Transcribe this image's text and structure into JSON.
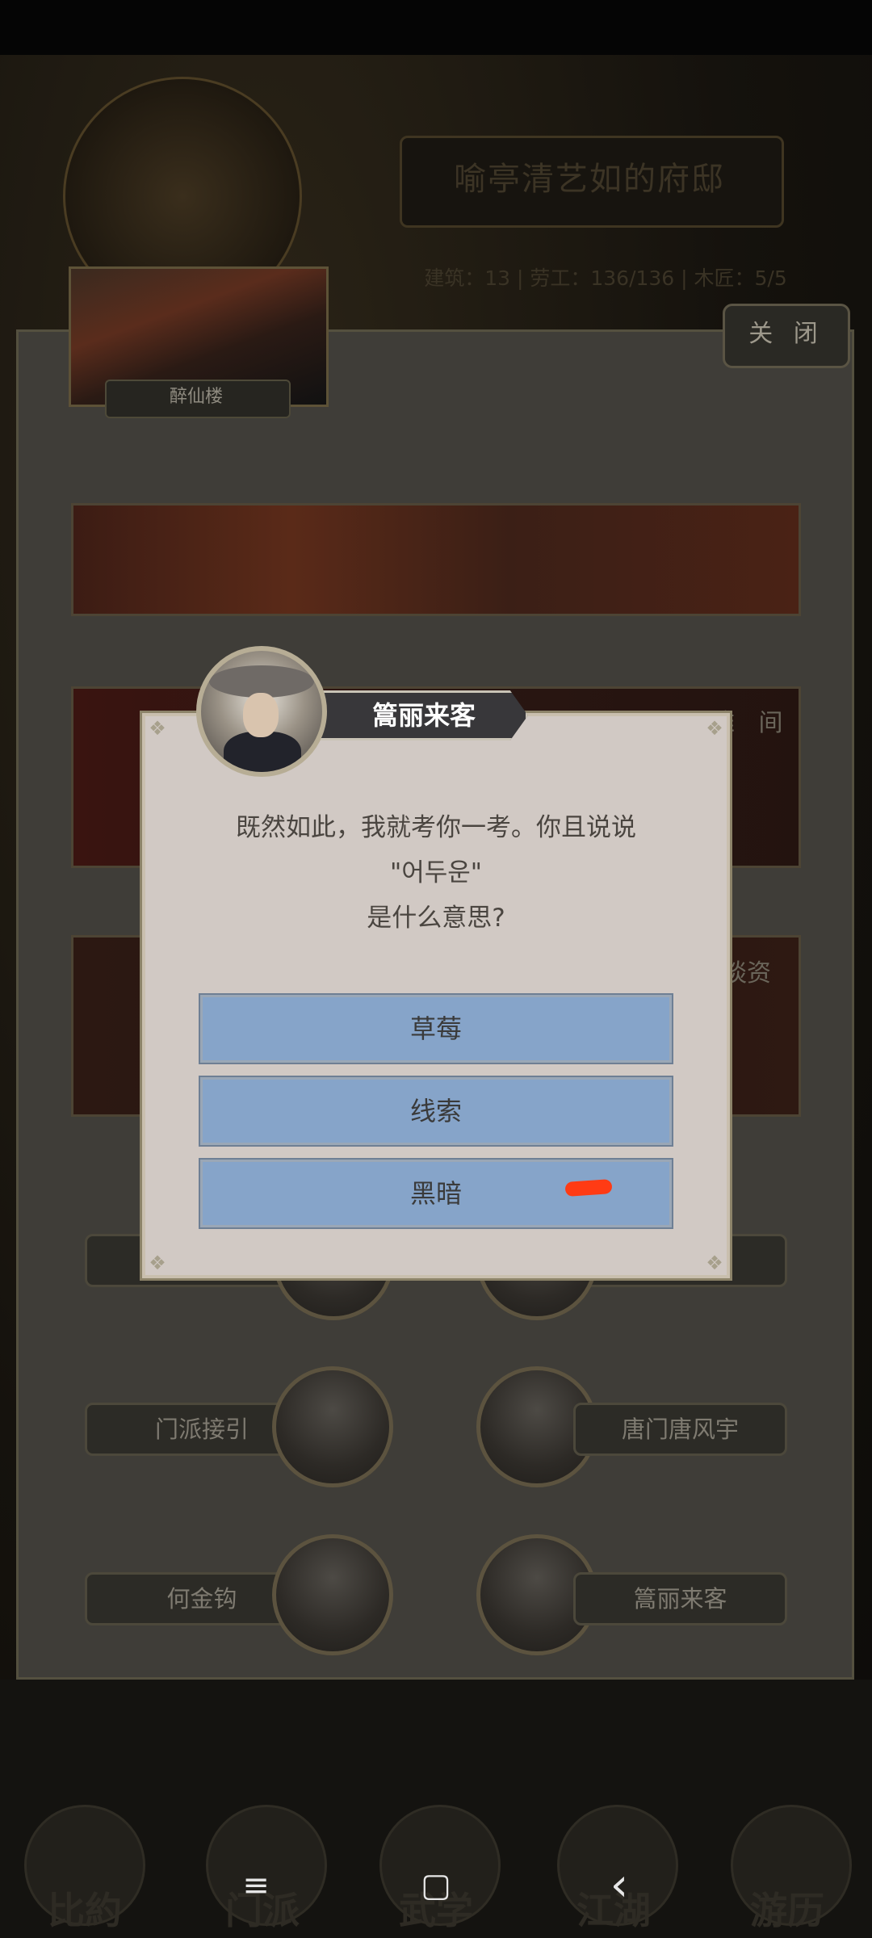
{
  "estate": {
    "title": "喻亭清艺如的府邸",
    "stats": "建筑：13  |  劳工：136/136  |  木匠：5/5"
  },
  "building": {
    "thumbnail_label": "醉仙楼",
    "close_label": "关 闭",
    "scene2_label": "雅 间",
    "scene3_label": "谈资"
  },
  "npcs": {
    "row2_left": "门派接引",
    "row2_right": "唐门唐风宇",
    "row3_left": "何金钩",
    "row3_right": "篙丽来客"
  },
  "dialog": {
    "speaker": "篙丽来客",
    "question_line1": "既然如此，我就考你一考。你且说说",
    "question_line2": "\"어두운\"",
    "question_line3": "是什么意思?",
    "options": [
      "草莓",
      "线索",
      "黑暗"
    ]
  },
  "bottom_nav": {
    "items": [
      "比約",
      "门派",
      "武学",
      "江湖",
      "游历"
    ]
  },
  "system_nav": {
    "menu_icon": "≡",
    "home_icon": "▢",
    "back_icon": "‹"
  },
  "colors": {
    "dialog_bg": "#d1c9c4",
    "option_bg": "#86a4c9",
    "annotation_mark": "#ff3b14"
  }
}
